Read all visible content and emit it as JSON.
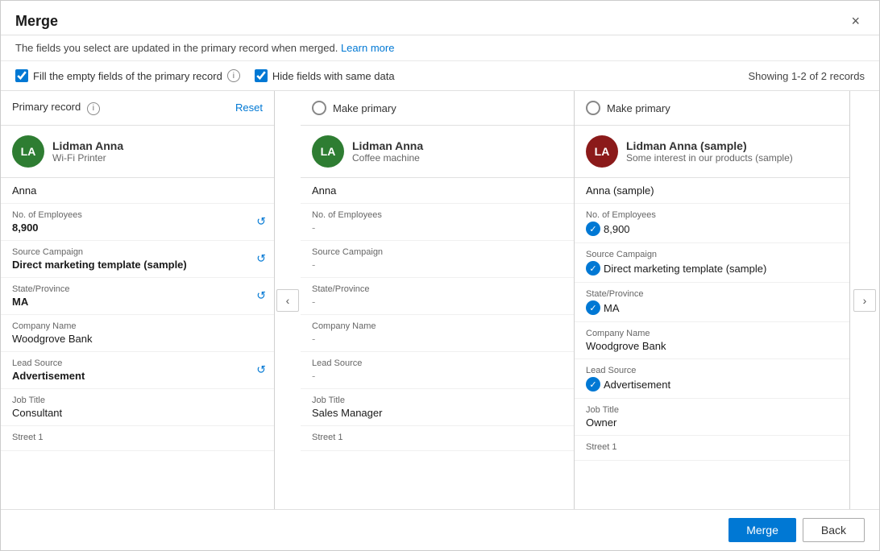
{
  "dialog": {
    "title": "Merge",
    "subtitle": "The fields you select are updated in the primary record when merged.",
    "learn_more": "Learn more",
    "close_label": "×"
  },
  "options": {
    "fill_empty_label": "Fill the empty fields of the primary record",
    "hide_same_label": "Hide fields with same data",
    "records_count": "Showing 1-2 of 2 records",
    "fill_empty_checked": true,
    "hide_same_checked": true
  },
  "columns": [
    {
      "id": "col1",
      "header_type": "primary",
      "header_label": "Primary record",
      "reset_label": "Reset",
      "avatar_initials": "LA",
      "avatar_class": "avatar-green",
      "record_name": "Lidman Anna",
      "record_sub": "Wi-Fi Printer",
      "first_name": "Anna",
      "fields": [
        {
          "label": "No. of Employees",
          "value": "8,900",
          "bold": true,
          "dash": false,
          "has_reset": true,
          "has_check": false
        },
        {
          "label": "Source Campaign",
          "value": "Direct marketing template (sample)",
          "bold": true,
          "dash": false,
          "has_reset": true,
          "has_check": false
        },
        {
          "label": "State/Province",
          "value": "MA",
          "bold": true,
          "dash": false,
          "has_reset": true,
          "has_check": false
        },
        {
          "label": "Company Name",
          "value": "Woodgrove Bank",
          "bold": false,
          "dash": false,
          "has_reset": false,
          "has_check": false
        },
        {
          "label": "Lead Source",
          "value": "Advertisement",
          "bold": true,
          "dash": false,
          "has_reset": true,
          "has_check": false
        },
        {
          "label": "Job Title",
          "value": "Consultant",
          "bold": false,
          "dash": false,
          "has_reset": false,
          "has_check": false
        },
        {
          "label": "Street 1",
          "value": "",
          "bold": false,
          "dash": false,
          "has_reset": false,
          "has_check": false
        }
      ]
    },
    {
      "id": "col2",
      "header_type": "make_primary",
      "header_label": "Make primary",
      "avatar_initials": "LA",
      "avatar_class": "avatar-green",
      "record_name": "Lidman Anna",
      "record_sub": "Coffee machine",
      "first_name": "Anna",
      "fields": [
        {
          "label": "No. of Employees",
          "value": "-",
          "bold": false,
          "dash": true,
          "has_reset": false,
          "has_check": false
        },
        {
          "label": "Source Campaign",
          "value": "-",
          "bold": false,
          "dash": true,
          "has_reset": false,
          "has_check": false
        },
        {
          "label": "State/Province",
          "value": "-",
          "bold": false,
          "dash": true,
          "has_reset": false,
          "has_check": false
        },
        {
          "label": "Company Name",
          "value": "-",
          "bold": false,
          "dash": true,
          "has_reset": false,
          "has_check": false
        },
        {
          "label": "Lead Source",
          "value": "-",
          "bold": false,
          "dash": true,
          "has_reset": false,
          "has_check": false
        },
        {
          "label": "Job Title",
          "value": "Sales Manager",
          "bold": false,
          "dash": false,
          "has_reset": false,
          "has_check": false
        },
        {
          "label": "Street 1",
          "value": "",
          "bold": false,
          "dash": false,
          "has_reset": false,
          "has_check": false
        }
      ]
    },
    {
      "id": "col3",
      "header_type": "make_primary",
      "header_label": "Make primary",
      "avatar_initials": "LA",
      "avatar_class": "avatar-dark-red",
      "record_name": "Lidman Anna (sample)",
      "record_sub": "Some interest in our products (sample)",
      "first_name": "Anna (sample)",
      "fields": [
        {
          "label": "No. of Employees",
          "value": "8,900",
          "bold": false,
          "dash": false,
          "has_reset": false,
          "has_check": true
        },
        {
          "label": "Source Campaign",
          "value": "Direct marketing template (sample)",
          "bold": false,
          "dash": false,
          "has_reset": false,
          "has_check": true
        },
        {
          "label": "State/Province",
          "value": "MA",
          "bold": false,
          "dash": false,
          "has_reset": false,
          "has_check": true
        },
        {
          "label": "Company Name",
          "value": "Woodgrove Bank",
          "bold": false,
          "dash": false,
          "has_reset": false,
          "has_check": false
        },
        {
          "label": "Lead Source",
          "value": "Advertisement",
          "bold": false,
          "dash": false,
          "has_reset": false,
          "has_check": true
        },
        {
          "label": "Job Title",
          "value": "Owner",
          "bold": false,
          "dash": false,
          "has_reset": false,
          "has_check": false
        },
        {
          "label": "Street 1",
          "value": "",
          "bold": false,
          "dash": false,
          "has_reset": false,
          "has_check": false
        }
      ]
    }
  ],
  "footer": {
    "merge_label": "Merge",
    "back_label": "Back"
  },
  "nav": {
    "left_arrow": "‹",
    "right_arrow": "›"
  }
}
